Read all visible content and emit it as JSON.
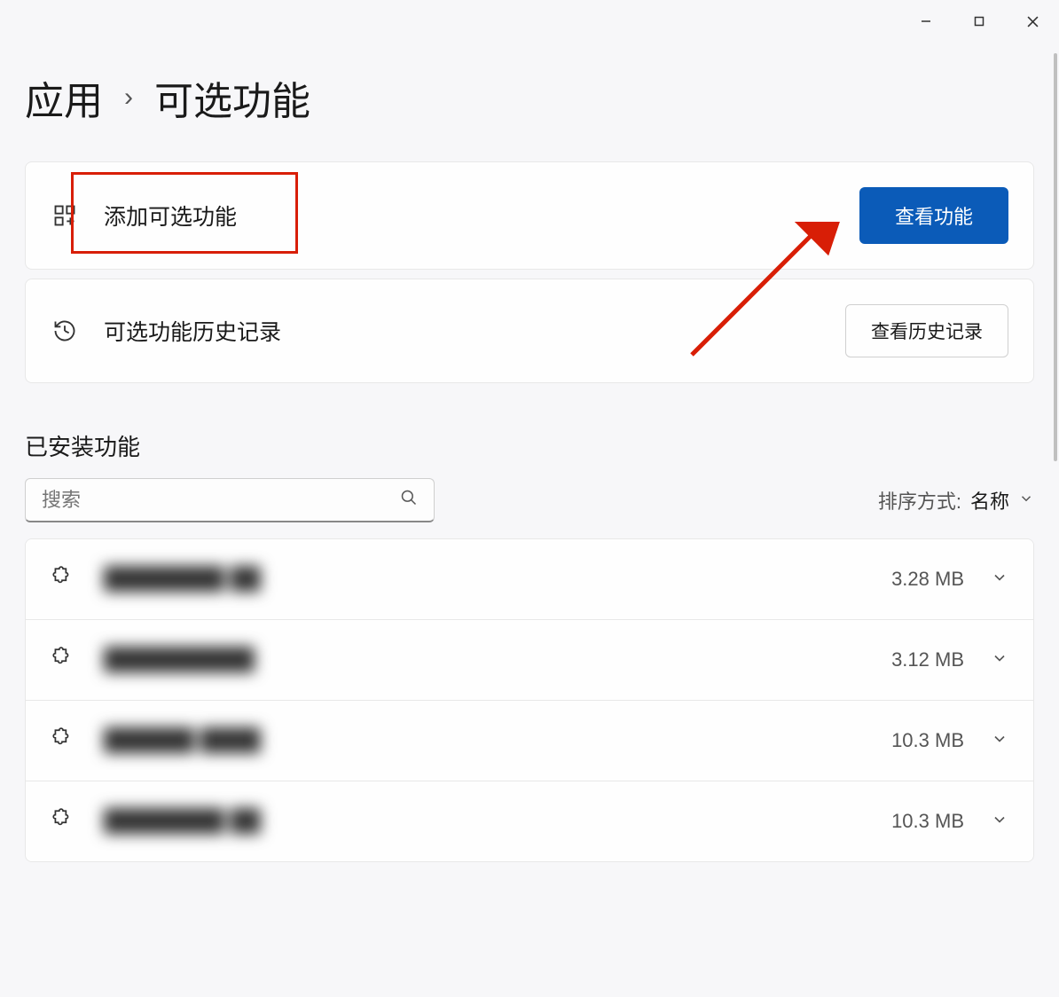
{
  "breadcrumb": {
    "parent": "应用",
    "current": "可选功能"
  },
  "cards": {
    "add": {
      "label": "添加可选功能",
      "button": "查看功能"
    },
    "history": {
      "label": "可选功能历史记录",
      "button": "查看历史记录"
    }
  },
  "installed": {
    "heading": "已安装功能",
    "search_placeholder": "搜索",
    "sort_label": "排序方式:",
    "sort_value": "名称"
  },
  "features": [
    {
      "name": "████████ ██",
      "size": "3.28 MB"
    },
    {
      "name": "██████████",
      "size": "3.12 MB"
    },
    {
      "name": "██████ ████",
      "size": "10.3 MB"
    },
    {
      "name": "████████ ██",
      "size": "10.3 MB"
    }
  ]
}
